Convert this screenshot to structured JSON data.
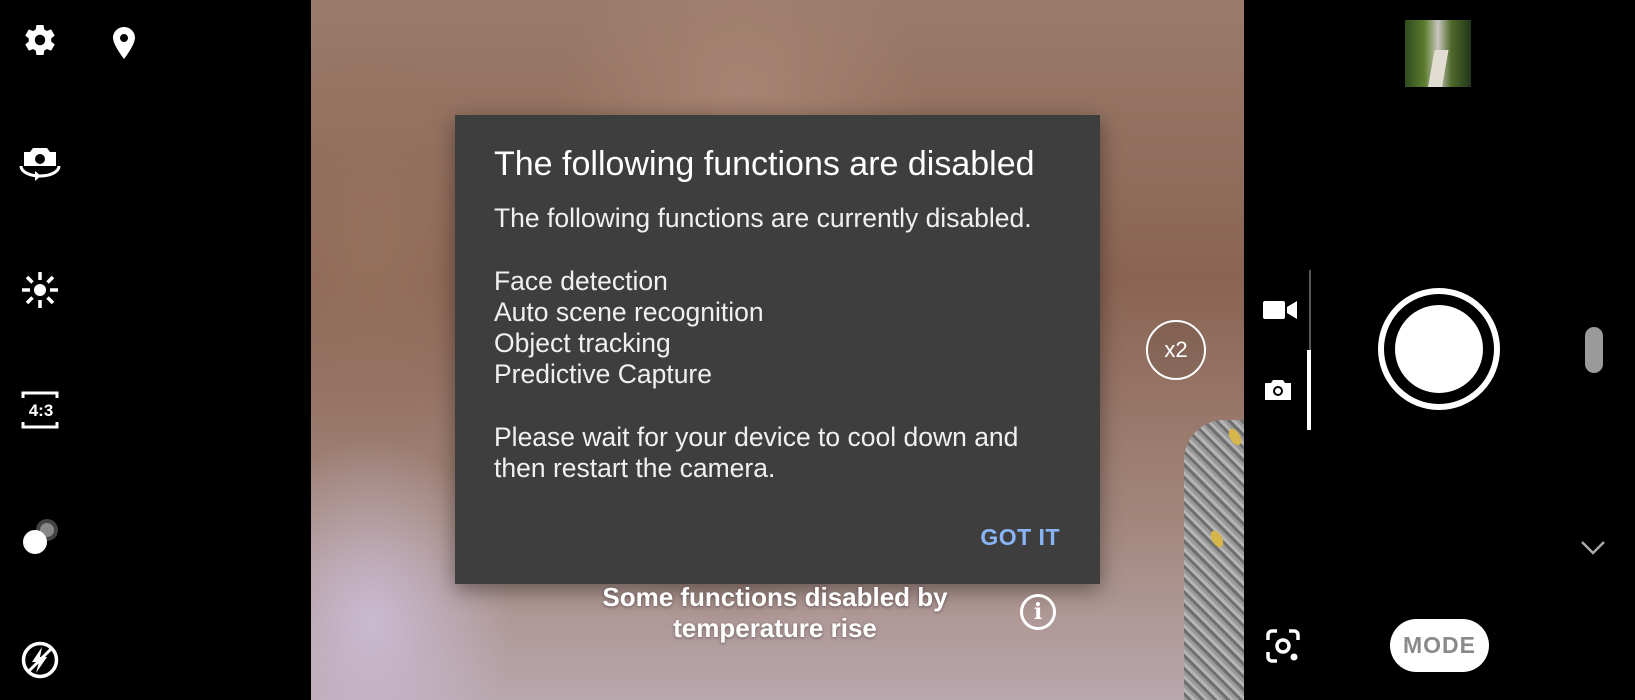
{
  "left_toolbar": {
    "icons": [
      "gear-icon",
      "location-pin-icon",
      "switch-camera-icon",
      "brightness-icon",
      "aspect-ratio-icon",
      "bokeh-icon",
      "flash-auto-icon"
    ],
    "aspect_ratio_label": "4:3"
  },
  "dialog": {
    "title": "The following functions are disabled",
    "message": "The following functions are currently disabled.\n\nFace detection\nAuto scene recognition\nObject tracking\nPredictive Capture\n\nPlease wait for your device to cool down and\nthen restart the camera.",
    "button_label": "GOT IT",
    "button_color": "#8ab4f8"
  },
  "status": {
    "temperature_warning": "Some functions disabled by temperature rise",
    "info_icon_label": "i"
  },
  "zoom": {
    "label": "x2"
  },
  "right_controls": {
    "video_mode_icon": "video-camera-icon",
    "photo_mode_icon": "photo-camera-icon",
    "selected_mode": "photo",
    "mode_button_label": "MODE",
    "gallery_thumbnail_icon": "gallery-thumbnail",
    "lens_icon": "google-lens-icon",
    "expand_icon": "chevron-down-icon"
  }
}
